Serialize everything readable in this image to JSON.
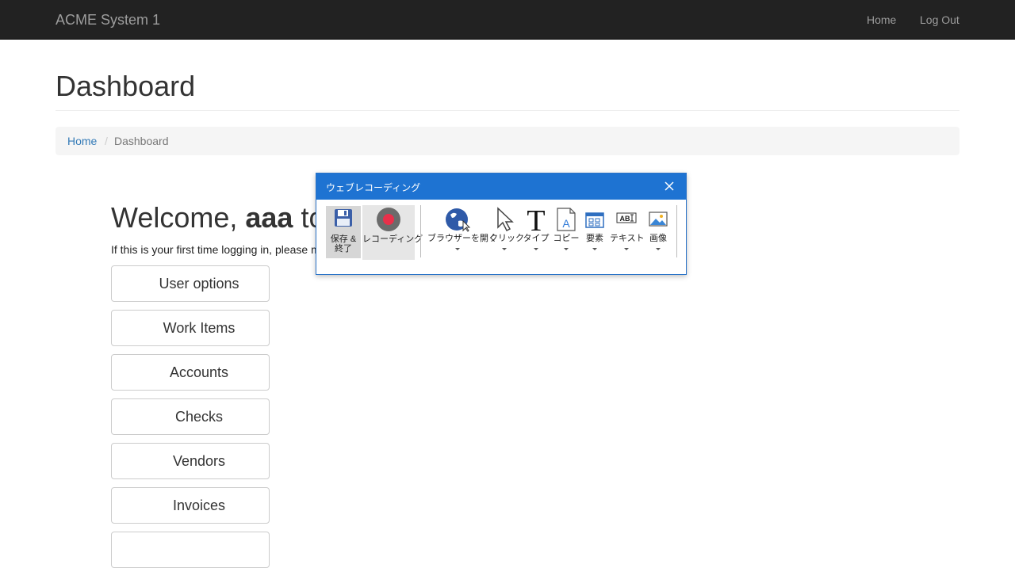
{
  "navbar": {
    "brand": "ACME System 1",
    "links": {
      "home": "Home",
      "logout": "Log Out"
    }
  },
  "page": {
    "title": "Dashboard",
    "breadcrumb": {
      "home": "Home",
      "separator": "/",
      "current": "Dashboard"
    },
    "welcome_prefix": "Welcome, ",
    "welcome_user": "aaa",
    "welcome_suffix": " to",
    "intro_text": "If this is your first time logging in, please m"
  },
  "menu": {
    "buttons": [
      "User options",
      "Work Items",
      "Accounts",
      "Checks",
      "Vendors",
      "Invoices"
    ]
  },
  "recorder": {
    "title": "ウェブレコーディング",
    "tools": {
      "save": "保存 &\n終了",
      "recording": "レコーディング",
      "open_browser": "ブラウザーを開く",
      "click": "クリック",
      "type": "タイプ",
      "copy": "コピー",
      "element": "要素",
      "text": "テキスト",
      "image": "画像"
    },
    "colors": {
      "titlebar": "#1e73d2",
      "record_dot": "#e8304a",
      "active_bg": "#d6d6d6"
    }
  }
}
